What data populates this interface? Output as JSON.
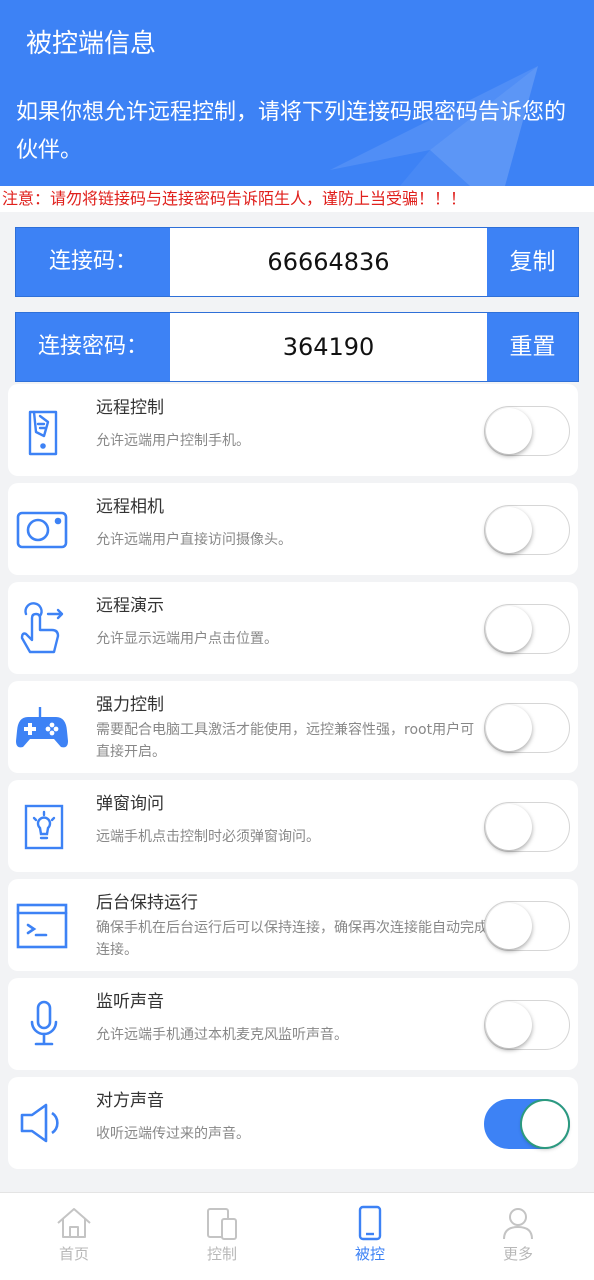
{
  "header": {
    "title": "被控端信息",
    "description": "如果你想允许远程控制，请将下列连接码跟密码告诉您的伙伴。"
  },
  "warning": "注意：请勿将链接码与连接密码告诉陌生人，谨防上当受骗！！！",
  "connection": {
    "code_label": "连接码：",
    "code_value": "66664836",
    "copy_label": "复制",
    "password_label": "连接密码：",
    "password_value": "364190",
    "reset_label": "重置"
  },
  "colors": {
    "accent": "#3d82f5",
    "warning": "#e0201c"
  },
  "settings": [
    {
      "icon": "remote-control-icon",
      "title": "远程控制",
      "desc": "允许远端用户控制手机。",
      "enabled": false
    },
    {
      "icon": "camera-icon",
      "title": "远程相机",
      "desc": "允许远端用户直接访问摄像头。",
      "enabled": false
    },
    {
      "icon": "touch-gesture-icon",
      "title": "远程演示",
      "desc": "允许显示远端用户点击位置。",
      "enabled": false
    },
    {
      "icon": "gamepad-icon",
      "title": "强力控制",
      "desc": "需要配合电脑工具激活才能使用，远控兼容性强，root用户可直接开启。",
      "enabled": false
    },
    {
      "icon": "lightbulb-icon",
      "title": "弹窗询问",
      "desc": "远端手机点击控制时必须弹窗询问。",
      "enabled": false
    },
    {
      "icon": "terminal-icon",
      "title": "后台保持运行",
      "desc": "确保手机在后台运行后可以保持连接，确保再次连接能自动完成连接。",
      "enabled": false
    },
    {
      "icon": "microphone-icon",
      "title": "监听声音",
      "desc": "允许远端手机通过本机麦克风监听声音。",
      "enabled": false
    },
    {
      "icon": "speaker-icon",
      "title": "对方声音",
      "desc": "收听远端传过来的声音。",
      "enabled": true
    }
  ],
  "nav": [
    {
      "icon": "home-icon",
      "label": "首页",
      "active": false
    },
    {
      "icon": "devices-icon",
      "label": "控制",
      "active": false
    },
    {
      "icon": "phone-icon",
      "label": "被控",
      "active": true
    },
    {
      "icon": "user-icon",
      "label": "更多",
      "active": false
    }
  ]
}
